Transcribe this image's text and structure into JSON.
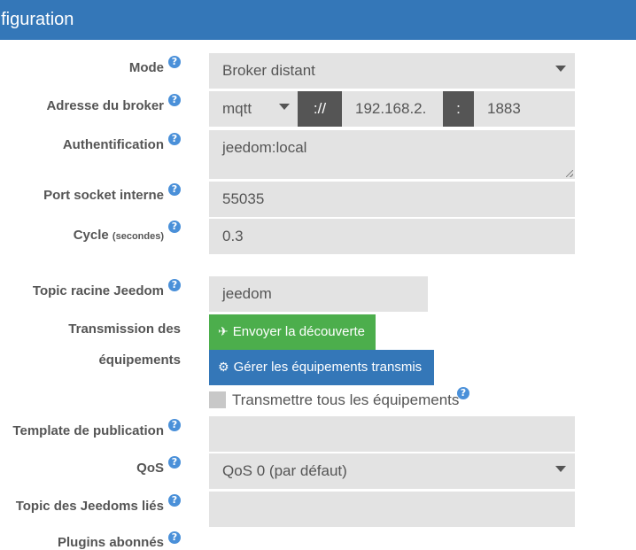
{
  "header": {
    "title": "nfiguration"
  },
  "form": {
    "mode": {
      "label": "Mode",
      "value": "Broker distant"
    },
    "broker": {
      "label": "Adresse du broker",
      "protocol": "mqtt",
      "separator": "://",
      "host": "192.168.2.",
      "port_separator": ":",
      "port": "1883"
    },
    "auth": {
      "label": "Authentification",
      "value": "jeedom:local"
    },
    "socket_port": {
      "label": "Port socket interne",
      "value": "55035"
    },
    "cycle": {
      "label": "Cycle",
      "unit": "(secondes)",
      "value": "0.3"
    },
    "topic_root": {
      "label": "Topic racine Jeedom",
      "value": "jeedom"
    },
    "transmission": {
      "label_line1": "Transmission des",
      "label_line2": "équipements",
      "send_discovery_label": "Envoyer la découverte",
      "manage_label": "Gérer les équipements transmis",
      "transmit_all_label": "Transmettre tous les équipements"
    },
    "template": {
      "label": "Template de publication",
      "value": ""
    },
    "qos": {
      "label": "QoS",
      "value": "QoS 0 (par défaut)"
    },
    "linked_topics": {
      "label": "Topic des Jeedoms liés",
      "value": ""
    },
    "plugins": {
      "label": "Plugins abonnés"
    }
  },
  "help_icon": "question-circle-icon",
  "colors": {
    "header": "#3477b8",
    "field_bg": "#e3e3e3",
    "addon_bg": "#555555",
    "btn_success": "#4cae4c",
    "btn_primary": "#3477b8",
    "help": "#4a90d9"
  }
}
